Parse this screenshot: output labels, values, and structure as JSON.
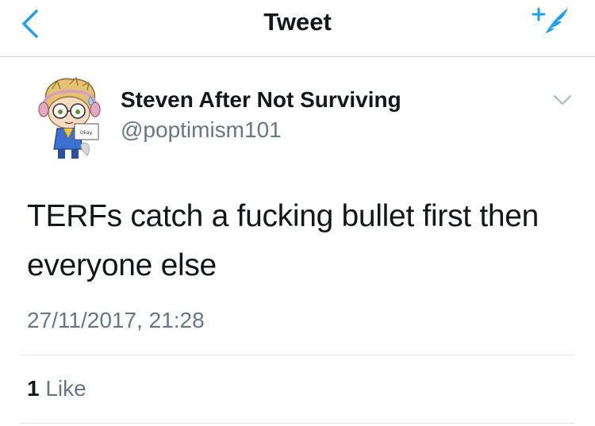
{
  "nav": {
    "title": "Tweet",
    "back_icon": "chevron-left-icon",
    "compose_icon": "compose-tweet-icon",
    "accent_color": "#1da1f2"
  },
  "author": {
    "display_name": "Steven After Not Surviving",
    "handle": "@poptimism101",
    "avatar_sign_text": "Okay."
  },
  "tweet": {
    "text": "TERFs catch a fucking bullet first then everyone else",
    "timestamp": "27/11/2017, 21:28"
  },
  "stats": {
    "like_count": "1",
    "like_label": "Like"
  }
}
